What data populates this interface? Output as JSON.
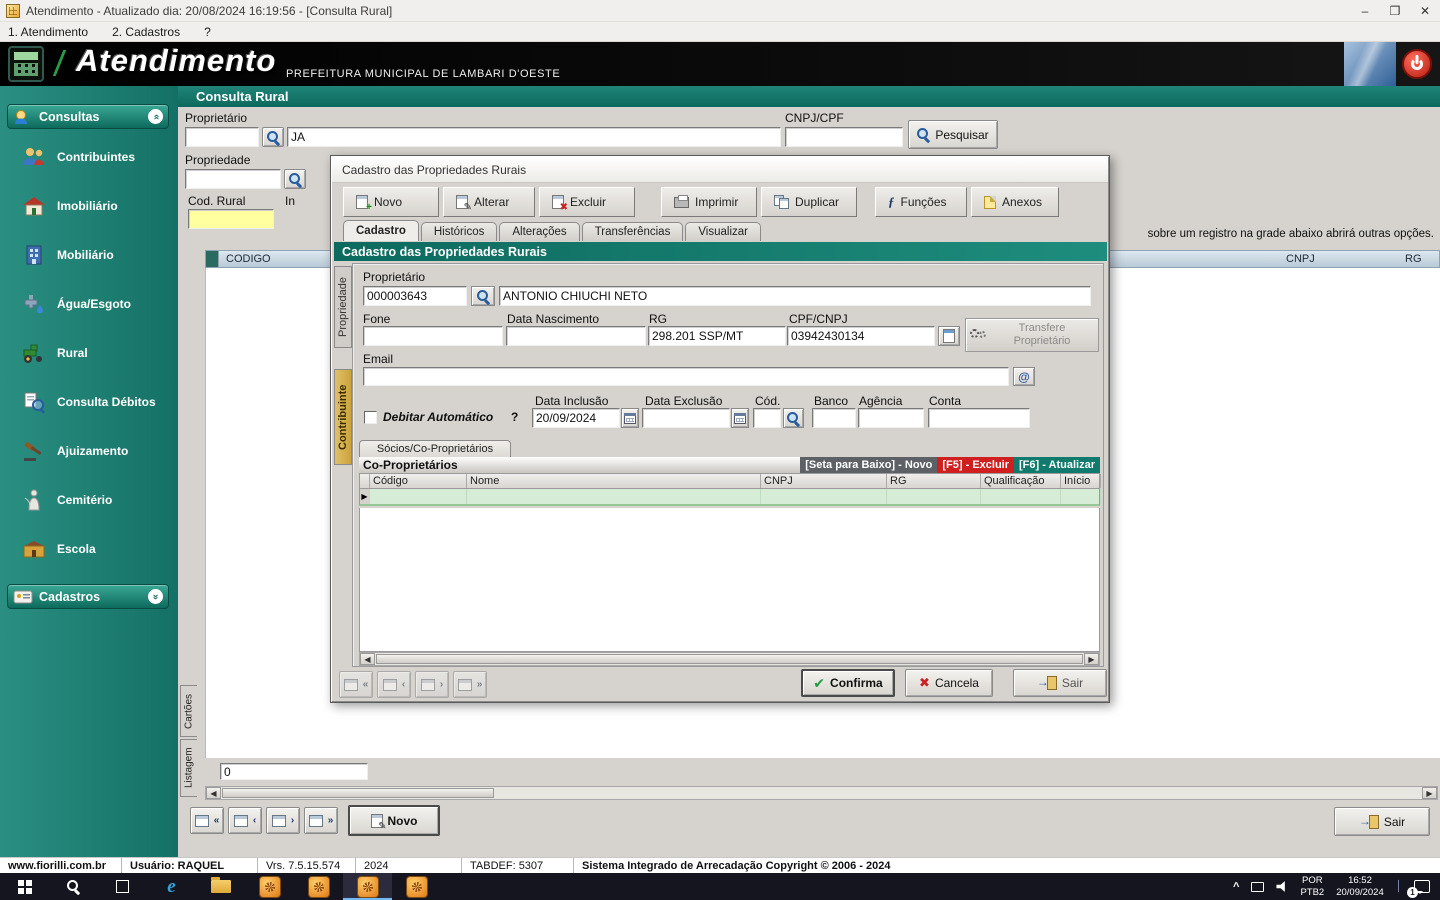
{
  "titlebar": {
    "title": "Atendimento - Atualizado dia: 20/08/2024 16:19:56 - [Consulta Rural]"
  },
  "menubar": {
    "items": [
      "1. Atendimento",
      "2. Cadastros",
      "?"
    ]
  },
  "banner": {
    "app": "Atendimento",
    "org": "PREFEITURA MUNICIPAL DE LAMBARI D'OESTE"
  },
  "sidebar": {
    "consultas": "Consultas",
    "items": [
      "Contribuintes",
      "Imobiliário",
      "Mobiliário",
      "Água/Esgoto",
      "Rural",
      "Consulta Débitos",
      "Ajuizamento",
      "Cemitério",
      "Escola"
    ],
    "cadastros": "Cadastros"
  },
  "consulta": {
    "title": "Consulta Rural",
    "proprietario_label": "Proprietário",
    "proprietario_name": "JA",
    "cnpj_label": "CNPJ/CPF",
    "pesquisar": "Pesquisar",
    "propriedade_label": "Propriedade",
    "cod_rural_label": "Cod. Rural",
    "inscricao_partial": "In",
    "hint": "sobre um registro na grade abaixo abrirá outras opções.",
    "grid": {
      "codigo": "CODIGO",
      "cnpj": "CNPJ",
      "rg": "RG"
    },
    "side_tabs": [
      "Cartões",
      "Listagem"
    ],
    "count": "0",
    "novo": "Novo",
    "sair": "Sair"
  },
  "dialog": {
    "caption": "Cadastro das Propriedades Rurais",
    "toolbar": [
      "Novo",
      "Alterar",
      "Excluir",
      "Imprimir",
      "Duplicar",
      "Funções",
      "Anexos"
    ],
    "tabs": [
      "Cadastro",
      "Históricos",
      "Alterações",
      "Transferências",
      "Visualizar"
    ],
    "section": "Cadastro das Propriedades Rurais",
    "side_tabs": [
      "Propriedade",
      "Contribuinte"
    ],
    "proprietario_label": "Proprietário",
    "proprietario_code": "000003643",
    "proprietario_name": "ANTONIO CHIUCHI NETO",
    "fone_label": "Fone",
    "nascimento_label": "Data Nascimento",
    "rg_label": "RG",
    "rg_value": "298.201 SSP/MT",
    "cpf_label": "CPF/CNPJ",
    "cpf_value": "03942430134",
    "transfere": "Transfere Proprietário",
    "email_label": "Email",
    "debitar_label": "Debitar Automático",
    "debitar_q": "?",
    "inclusao_label": "Data Inclusão",
    "inclusao_value": "20/09/2024",
    "exclusao_label": "Data Exclusão",
    "cod_label": "Cód.",
    "banco_label": "Banco",
    "agencia_label": "Agência",
    "conta_label": "Conta",
    "socios_tab": "Sócios/Co-Proprietários",
    "coprop": "Co-Proprietários",
    "hk_novo": "[Seta para Baixo] - Novo",
    "hk_excluir": "[F5] - Excluir",
    "hk_atualizar": "[F6] - Atualizar",
    "grid_headers": [
      "Código",
      "Nome",
      "CNPJ",
      "RG",
      "Qualificação",
      "Início"
    ],
    "confirma": "Confirma",
    "cancela": "Cancela",
    "sair": "Sair"
  },
  "statusbar": {
    "items": [
      "www.fiorilli.com.br",
      "Usuário: RAQUEL",
      "Vrs. 7.5.15.574",
      "2024",
      "TABDEF: 5307",
      "Sistema Integrado de Arrecadação Copyright © 2006 - 2024"
    ]
  },
  "taskbar": {
    "lang1": "POR",
    "lang2": "PTB2",
    "time": "16:52",
    "date": "20/09/2024",
    "badge": "1"
  },
  "colors": {
    "teal": "#147064",
    "header_teal": "#0d6a5e",
    "chip_red": "#cf1f1f",
    "chip_teal": "#0f7a6d",
    "row_green": "#d6ecd6",
    "field_yellow": "#ffffa0"
  }
}
